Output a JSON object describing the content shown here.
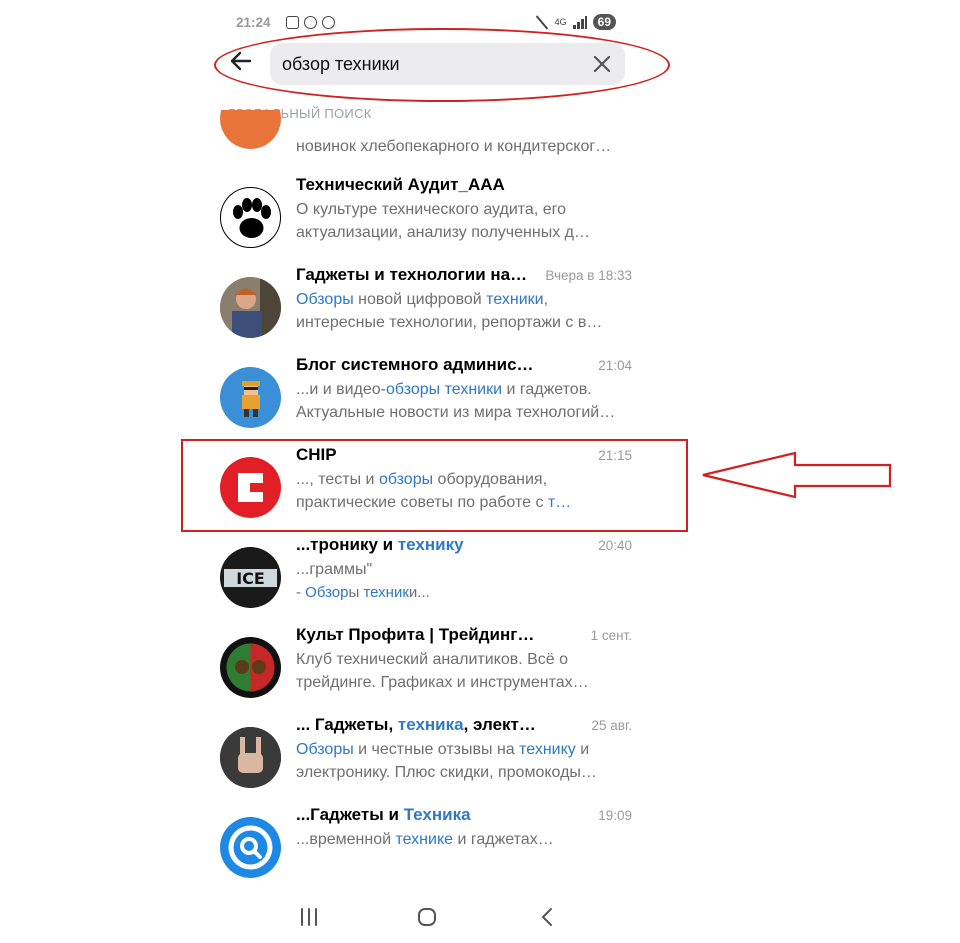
{
  "status": {
    "time": "21:24",
    "network": "4G",
    "battery": "69"
  },
  "search": {
    "query": "обзор техники"
  },
  "section_header": "ГЛОБАЛЬНЫЙ ПОИСК",
  "partial": {
    "text": "новинок хлебопекарного и кондитерског…"
  },
  "items": [
    {
      "title": "Технический Аудит_ААА",
      "time": "",
      "line1": "О культуре технического аудита, его",
      "line2": "актуализации, анализу полученных д…",
      "avatar_icon": "paw-icon"
    },
    {
      "title": "Гаджеты и технологии на…",
      "time": "Вчера в 18:33",
      "line1_parts": [
        "Обзоры",
        " новой цифровой ",
        "техники",
        ","
      ],
      "line2": "интересные технологии, репортажи с в…",
      "avatar_icon": "person-photo"
    },
    {
      "title": "Блог системного администрато…",
      "time": "21:04",
      "line1_parts": [
        "...и и видео-",
        "обзоры",
        " ",
        "техники",
        " и гаджетов."
      ],
      "line2": "Актуальные новости из мира технологий…",
      "avatar_icon": "pixel-character-icon"
    },
    {
      "title": "CHIP",
      "time": "21:15",
      "line1_parts": [
        "..., тесты и ",
        "обзоры",
        " оборудования,"
      ],
      "line2_parts": [
        "практические советы по работе с ",
        "т…"
      ],
      "avatar_icon": "chip-logo-icon"
    },
    {
      "title_parts": [
        "...тронику и ",
        "технику"
      ],
      "time": "20:40",
      "line1": "...граммы\"",
      "line2_parts": [
        "- ",
        "Обзор",
        "ы ",
        "техник",
        "и..."
      ],
      "avatar_icon": "ice-logo-icon"
    },
    {
      "title": "Культ Профита | Трейдинг и те…",
      "time": "1 сент.",
      "line1": "Клуб технический аналитиков. Всё о",
      "line2": "трейдинге. Графиках и инструментах…",
      "avatar_icon": "bull-bear-icon"
    },
    {
      "title_parts": [
        "... Гаджеты, ",
        "техника",
        ", электрон…"
      ],
      "time": "25 авг.",
      "line1_parts": [
        "Обзоры",
        " и честные отзывы на ",
        "технику",
        " и"
      ],
      "line2": "электронику. Плюс скидки, промокоды…",
      "avatar_icon": "rock-hand-icon"
    },
    {
      "title_parts": [
        "...Гаджеты и ",
        "Техника"
      ],
      "time": "19:09",
      "line1_parts": [
        "...временной ",
        "технике",
        " и гаджетах…"
      ],
      "avatar_icon": "search-q-icon"
    }
  ],
  "colors": {
    "highlight": "#2f78c4",
    "annotation": "#d02020"
  }
}
